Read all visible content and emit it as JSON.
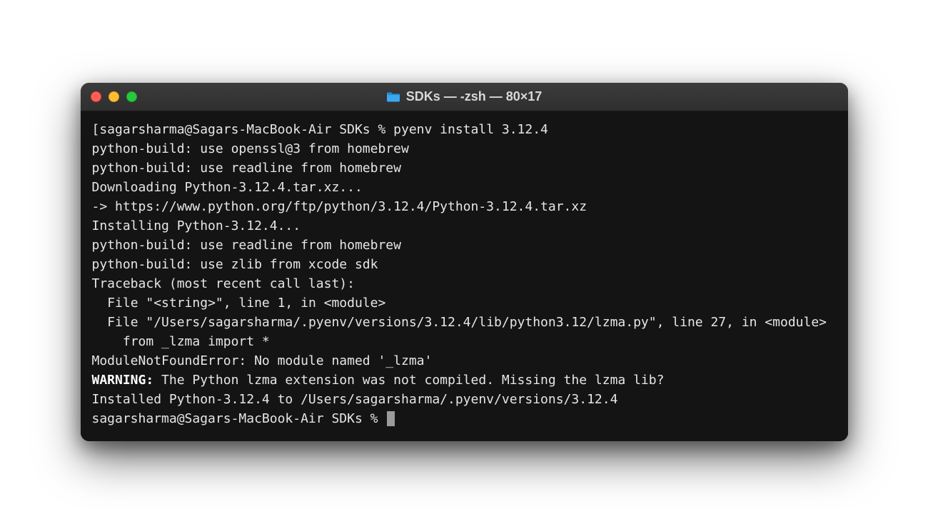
{
  "window": {
    "title": "SDKs — -zsh — 80×17",
    "icon": "folder-icon"
  },
  "terminal": {
    "lines": [
      {
        "pre": "[",
        "text": "sagarsharma@Sagars-MacBook-Air SDKs % pyenv install 3.12.4"
      },
      {
        "text": "python-build: use openssl@3 from homebrew"
      },
      {
        "text": "python-build: use readline from homebrew"
      },
      {
        "text": "Downloading Python-3.12.4.tar.xz..."
      },
      {
        "text": "-> https://www.python.org/ftp/python/3.12.4/Python-3.12.4.tar.xz"
      },
      {
        "text": "Installing Python-3.12.4..."
      },
      {
        "text": "python-build: use readline from homebrew"
      },
      {
        "text": "python-build: use zlib from xcode sdk"
      },
      {
        "text": "Traceback (most recent call last):"
      },
      {
        "text": "  File \"<string>\", line 1, in <module>"
      },
      {
        "text": "  File \"/Users/sagarsharma/.pyenv/versions/3.12.4/lib/python3.12/lzma.py\", line 27, in <module>"
      },
      {
        "text": "    from _lzma import *"
      },
      {
        "text": "ModuleNotFoundError: No module named '_lzma'"
      },
      {
        "bold": "WARNING:",
        "text": " The Python lzma extension was not compiled. Missing the lzma lib?"
      },
      {
        "text": "Installed Python-3.12.4 to /Users/sagarsharma/.pyenv/versions/3.12.4"
      },
      {
        "text": "sagarsharma@Sagars-MacBook-Air SDKs % ",
        "cursor": true
      }
    ]
  }
}
